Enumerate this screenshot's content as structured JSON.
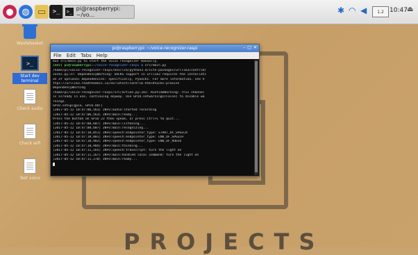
{
  "taskbar": {
    "window_button_label": "pi@raspberrypi: ~/vo...",
    "clock": "10:47",
    "volume_box": "1.2"
  },
  "desktop": {
    "icons": [
      {
        "label": "Wastebasket"
      },
      {
        "label": "Start dev terminal"
      },
      {
        "label": "Check audio"
      },
      {
        "label": "Check wifi"
      },
      {
        "label": "Test voice"
      }
    ],
    "wallpaper_text": "PROJECTS"
  },
  "terminal": {
    "title": "pi@raspberrypi: ~/voice-recognizer-raspi",
    "menu": [
      "File",
      "Edit",
      "Tabs",
      "Help"
    ],
    "lines": [
      {
        "prompt": "",
        "text": "Run src/main.py to start the voice recognizer manually."
      },
      {
        "prompt": "(env) pi@raspberrypi:",
        "path": "~/voice-recognizer-raspi $",
        "text": " src/main.py"
      },
      {
        "prompt": "",
        "text": "/home/pi/voice-recognizer-raspi/env/lib/python3.4/site-packages/urllib3/contrib/"
      },
      {
        "prompt": "",
        "text": "socks.py:37: DependencyWarning: SOCKS support in urllib3 requires the installati"
      },
      {
        "prompt": "",
        "text": "on of optional dependencies: specifically, PySocks. For more information, see h"
      },
      {
        "prompt": "",
        "text": "ttps://urllib3.readthedocs.io/en/latest/contrib.html#socks-proxies"
      },
      {
        "prompt": "",
        "text": "  DependencyWarning"
      },
      {
        "prompt": "",
        "text": "/home/pi/voice-recognizer-raspi/src/action.py:242: RuntimeWarning: This channel"
      },
      {
        "prompt": "",
        "text": "is already in use, continuing anyway.  Use GPIO.setwarnings(False) to disable wa"
      },
      {
        "prompt": "",
        "text": "rnings."
      },
      {
        "prompt": "",
        "text": "  GPIO.setup(gpio, GPIO.OUT)"
      },
      {
        "prompt": "",
        "text": "[2017-05-12 10:47:06,563] INFO:audio:started recording"
      },
      {
        "prompt": "",
        "text": "[2017-05-12 10:47:06,563] INFO:main:ready..."
      },
      {
        "prompt": "",
        "text": "Press the button on GPIO 23 then speak, or press Ctrl+C to quit..."
      },
      {
        "prompt": "",
        "text": "[2017-05-12 10:47:08,607] INFO:main:listening..."
      },
      {
        "prompt": "",
        "text": "[2017-05-12 10:47:08,607] INFO:main:recognizing..."
      },
      {
        "prompt": "",
        "text": "[2017-05-12 10:47:10,051] INFO:speech:endpointer_type: START_OF_SPEECH"
      },
      {
        "prompt": "",
        "text": "[2017-05-12 10:47:10,801] INFO:speech:endpointer_type: END_OF_SPEECH"
      },
      {
        "prompt": "",
        "text": "[2017-05-12 10:47:10,982] INFO:speech:endpointer_type: END_OF_AUDIO"
      },
      {
        "prompt": "",
        "text": "[2017-05-12 10:47:10,984] INFO:main:thinking..."
      },
      {
        "prompt": "",
        "text": "[2017-05-12 10:47:11,165] INFO:speech:transcript: turn the light on"
      },
      {
        "prompt": "",
        "text": "[2017-05-12 10:47:11,167] INFO:main:handled local command: turn the light on"
      },
      {
        "prompt": "",
        "text": "[2017-05-12 10:47:11,270] INFO:main:ready..."
      }
    ]
  },
  "colors": {
    "title_bar": "#4b7ec9",
    "prompt": "#5ec35e",
    "path": "#6aa0ff"
  }
}
